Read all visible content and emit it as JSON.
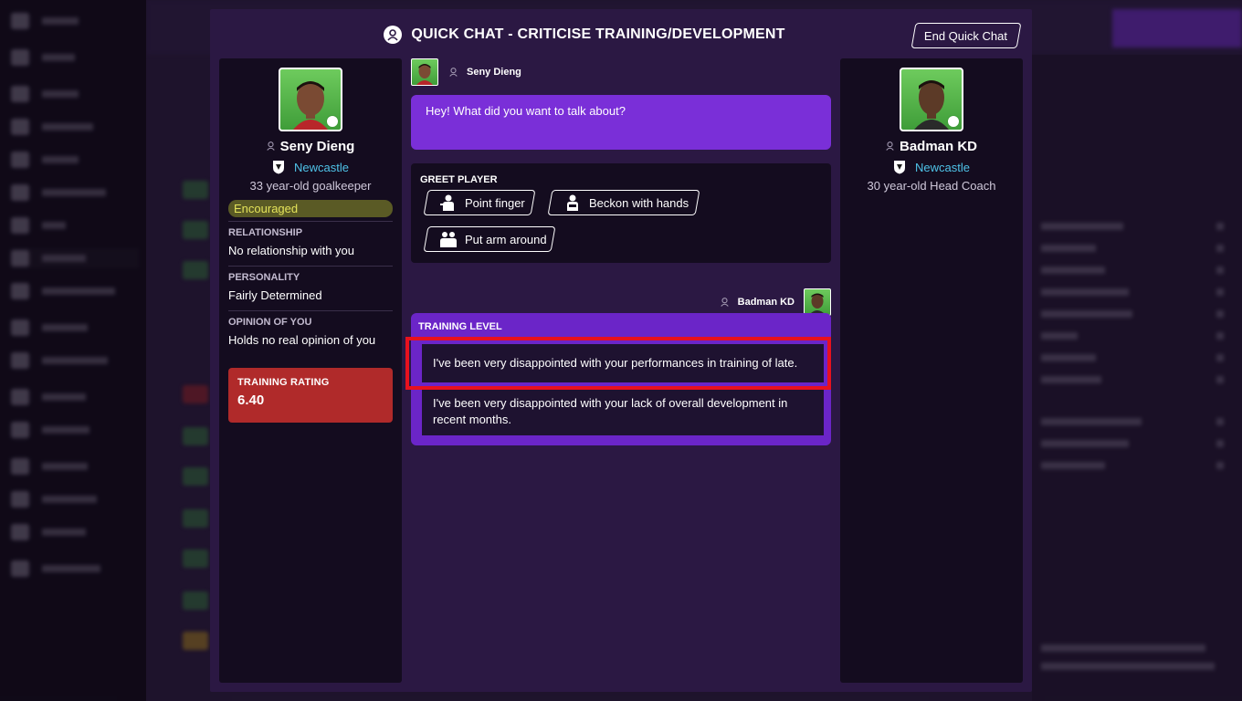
{
  "modal": {
    "title": "QUICK CHAT - CRITICISE TRAINING/DEVELOPMENT",
    "end_chat_label": "End Quick Chat"
  },
  "player": {
    "name": "Seny Dieng",
    "club": "Newcastle",
    "description": "33 year-old goalkeeper",
    "morale": "Encouraged",
    "relationship_label": "RELATIONSHIP",
    "relationship_value": "No relationship with you",
    "personality_label": "PERSONALITY",
    "personality_value": "Fairly Determined",
    "opinion_label": "OPINION OF YOU",
    "opinion_value": "Holds no real opinion of you",
    "rating_label": "TRAINING RATING",
    "rating_value": "6.40"
  },
  "coach": {
    "name": "Badman KD",
    "club": "Newcastle",
    "description": "30 year-old Head Coach"
  },
  "chat": {
    "player_message": "Hey! What did you want to talk about?",
    "greet_title": "GREET PLAYER",
    "greet_options": [
      "Point finger",
      "Beckon with hands",
      "Put arm around"
    ],
    "response_title": "TRAINING LEVEL",
    "responses": [
      "I've been very disappointed with your performances in training of late.",
      "I've been very disappointed with your lack of overall development in recent months."
    ]
  },
  "colors": {
    "modal_bg": "#2b1843",
    "panel_bg": "#140c1f",
    "bubble_purple": "#7a2fd8",
    "response_purple": "#6b25c8",
    "club_link": "#4fc3e8",
    "morale_text": "#e4e35a",
    "rating_red": "#b02a2a",
    "highlight_red": "#e8111e"
  },
  "icons": {
    "title": "quick-chat-icon",
    "person": "person-icon",
    "crest": "club-crest-icon",
    "gestures": [
      "point-finger-icon",
      "beckon-hands-icon",
      "arm-around-icon"
    ]
  }
}
